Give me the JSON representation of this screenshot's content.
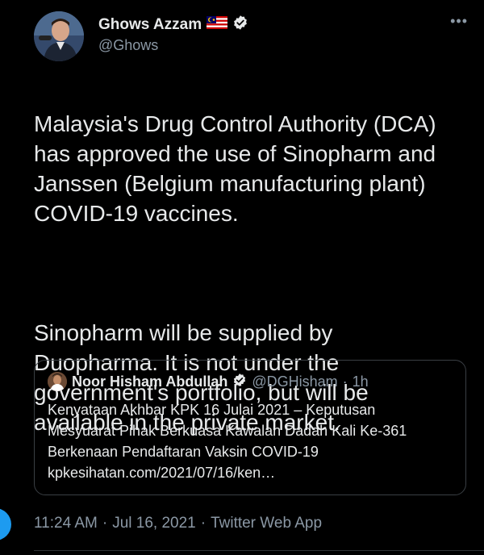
{
  "tweet": {
    "author": {
      "display_name": "Ghows Azzam",
      "handle": "@Ghows",
      "flag_emoji": "malaysia-flag",
      "verified": true
    },
    "more_label": "•••",
    "paragraphs": [
      "Malaysia's Drug Control Authority (DCA)\nhas approved the use of Sinopharm and\nJanssen (Belgium manufacturing plant)\nCOVID-19 vaccines.",
      "Sinopharm will be supplied by\nDuopharma. It is not under the\ngovernment's portfolio, but will be\navailable in the private market."
    ],
    "quoted": {
      "display_name": "Noor Hisham Abdullah",
      "handle": "@DGHisham",
      "separator": "·",
      "time": "1h",
      "verified": true,
      "lines": [
        "Kenyataan Akhbar KPK 16 Julai 2021 – Keputusan",
        "Mesyuarat Pihak Berkuasa Kawalan Dadah Kali Ke-361",
        "Berkenaan Pendaftaran Vaksin COVID-19",
        "kpkesihatan.com/2021/07/16/ken…"
      ]
    },
    "footer": {
      "time": "11:24 AM",
      "dot1": "·",
      "date": "Jul 16, 2021",
      "dot2": "·",
      "source": "Twitter Web App"
    }
  },
  "colors": {
    "background": "#000000",
    "text_primary": "#e7e9ea",
    "text_secondary": "#8b98a5",
    "border": "#3a3f44",
    "accent": "#1d9bf0"
  }
}
